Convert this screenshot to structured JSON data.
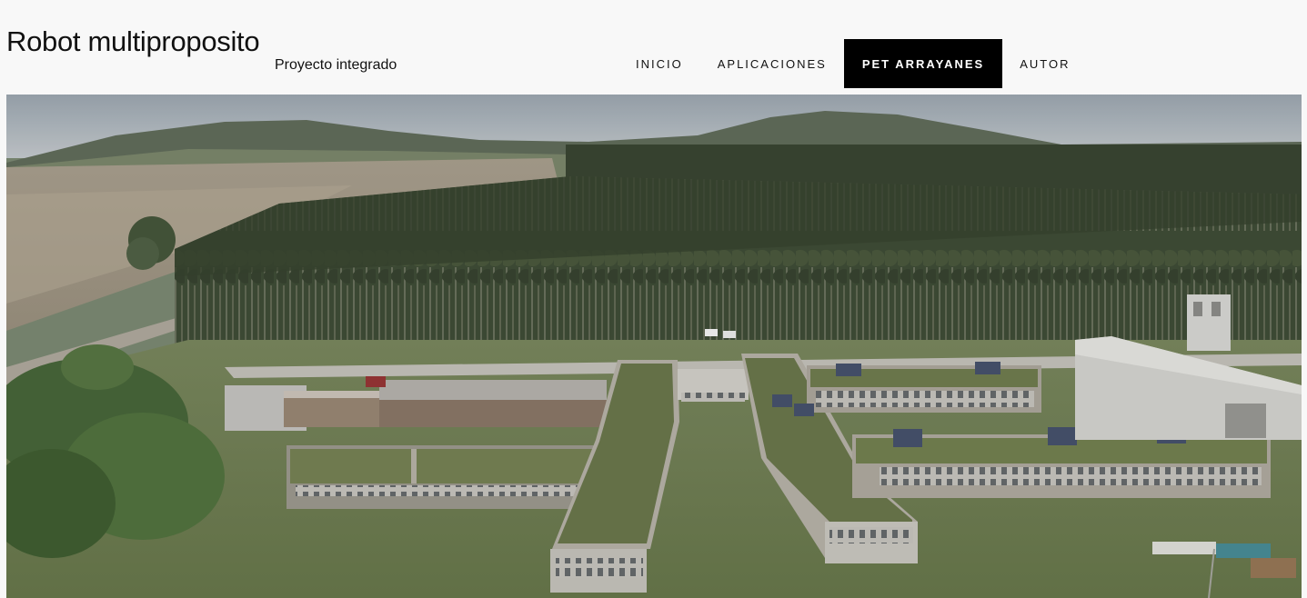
{
  "header": {
    "site_title": "Robot multiproposito",
    "tagline": "Proyecto integrado"
  },
  "nav": {
    "items": [
      {
        "label": "INICIO",
        "active": false
      },
      {
        "label": "APLICACIONES",
        "active": false
      },
      {
        "label": "PET ARRAYANES",
        "active": true
      },
      {
        "label": "AUTOR",
        "active": false
      }
    ]
  },
  "colors": {
    "active_nav_bg": "#000000",
    "active_nav_text": "#ffffff",
    "page_bg": "#f8f8f8"
  }
}
